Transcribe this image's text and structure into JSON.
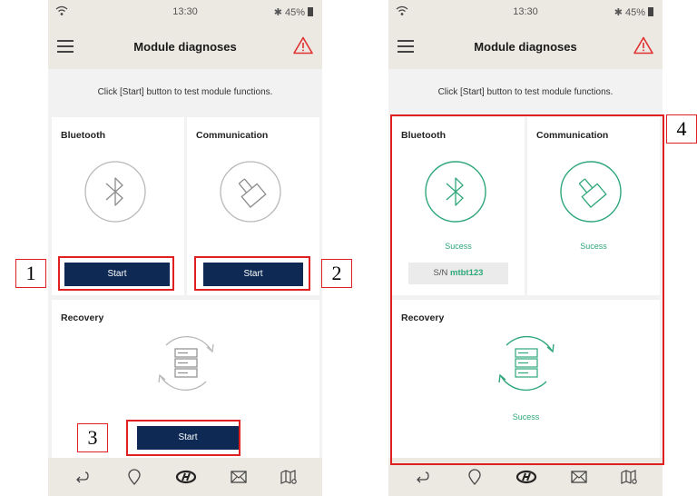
{
  "status_bar": {
    "time": "13:30",
    "battery": "45%"
  },
  "header": {
    "title": "Module diagnoses"
  },
  "instruction": "Click [Start] button to test module functions.",
  "left_screen": {
    "bluetooth": {
      "label": "Bluetooth",
      "button": "Start"
    },
    "communication": {
      "label": "Communication",
      "button": "Start"
    },
    "recovery": {
      "label": "Recovery",
      "button": "Start"
    }
  },
  "right_screen": {
    "bluetooth": {
      "label": "Bluetooth",
      "status": "Sucess",
      "serial_prefix": "S/N",
      "serial_value": "mtbt123"
    },
    "communication": {
      "label": "Communication",
      "status": "Sucess"
    },
    "recovery": {
      "label": "Recovery",
      "status": "Sucess"
    }
  },
  "callouts": [
    "1",
    "2",
    "3",
    "4"
  ],
  "colors": {
    "navy": "#0e2a54",
    "success": "#2fa77a",
    "idle": "#b8b8b8",
    "callout": "#e02020",
    "bar": "#ece8e2"
  },
  "bottom_nav": [
    "back-icon",
    "location-pin-icon",
    "hyundai-logo-icon",
    "mail-icon",
    "map-icon"
  ]
}
